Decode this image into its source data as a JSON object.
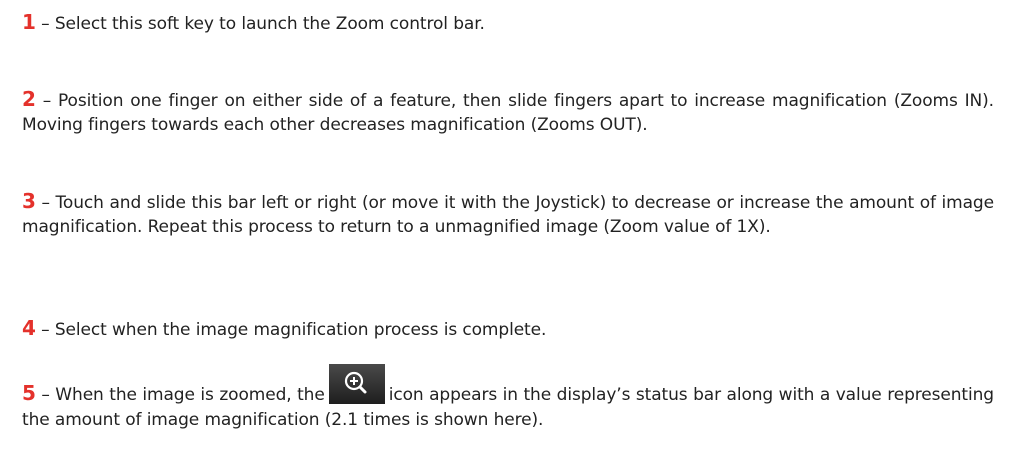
{
  "items": [
    {
      "number": "1",
      "text": " – Select this soft key to launch the Zoom control bar."
    },
    {
      "number": "2",
      "text": " – Position one finger on either side of a feature, then slide fingers apart to increase magnification (Zooms IN). Moving fingers towards each other decreases magnification (Zooms OUT)."
    },
    {
      "number": "3",
      "text": " – Touch and slide this bar left or right (or move it with the Joystick) to decrease or increase the amount of image magnification. Repeat this process to return to a unmagnified image (Zoom value of 1X)."
    },
    {
      "number": "4",
      "text": " – Select when the image magnification process is complete."
    },
    {
      "number": "5",
      "text_before": " – When the image is zoomed, the",
      "icon": "zoom-in-icon",
      "text_after": "icon appears in the display’s status bar along with a value representing the amount of image magnification (2.1 times is shown here)."
    }
  ],
  "colors": {
    "number": "#e4312b",
    "icon_background": "#2a2a2a"
  }
}
